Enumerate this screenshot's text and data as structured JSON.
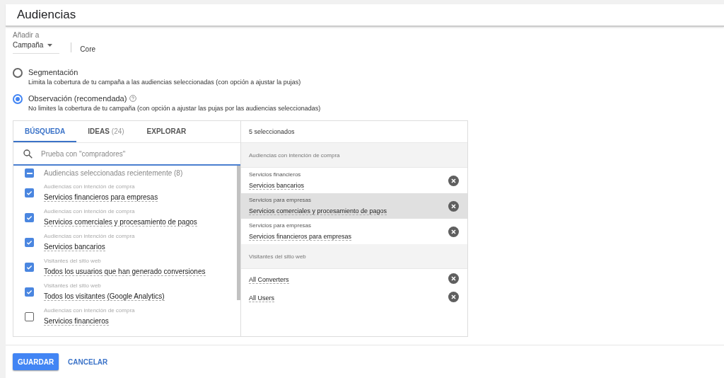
{
  "title": "Audiencias",
  "add_to": {
    "label": "Añadir a",
    "value": "Campaña",
    "campaign": "Core"
  },
  "options": [
    {
      "label": "Segmentación",
      "description": "Limita la cobertura de tu campaña a las audiencias seleccionadas (con opción a ajustar la pujas)",
      "selected": false,
      "help": false
    },
    {
      "label": "Observación (recomendada)",
      "description": "No limites la cobertura de tu campaña (con opción a ajustar las pujas por las audiencias seleccionadas)",
      "selected": true,
      "help": true
    }
  ],
  "tabs": [
    {
      "label": "BÚSQUEDA",
      "selected": true
    },
    {
      "label": "IDEAS",
      "count": "(24)",
      "selected": false
    },
    {
      "label": "EXPLORAR",
      "selected": false
    }
  ],
  "search": {
    "placeholder": "Prueba con \"compradores\""
  },
  "group_header": {
    "label": "Audiencias seleccionadas recientemente (8)",
    "indeterminate": true
  },
  "audiences": [
    {
      "category": "Audiencias con intención de compra",
      "name": "Servicios financieros para empresas",
      "checked": true
    },
    {
      "category": "Audiencias con intención de compra",
      "name": "Servicios comerciales y procesamiento de pagos",
      "checked": true
    },
    {
      "category": "Audiencias con intención de compra",
      "name": "Servicios bancarios",
      "checked": true
    },
    {
      "category": "Visitantes del sitio web",
      "name": "Todos los usuarios que han generado conversiones",
      "checked": true
    },
    {
      "category": "Visitantes del sitio web",
      "name": "Todos los visitantes (Google Analytics)",
      "checked": true
    },
    {
      "category": "Audiencias con intención de compra",
      "name": "Servicios financieros",
      "checked": false
    }
  ],
  "selected_panel": {
    "count_label": "5 seleccionados",
    "groups": [
      {
        "title": "Audiencias con intención de compra",
        "items": [
          {
            "parent": "Servicios financieros",
            "name": "Servicios bancarios",
            "highlighted": false
          },
          {
            "parent": "Servicios para empresas",
            "name": "Servicios comerciales y procesamiento de pagos",
            "highlighted": true
          },
          {
            "parent": "Servicios para empresas",
            "name": "Servicios financieros para empresas",
            "highlighted": false
          }
        ]
      },
      {
        "title": "Visitantes del sitio web",
        "items": [
          {
            "name": "All Converters",
            "highlighted": false
          },
          {
            "name": "All Users",
            "highlighted": false
          }
        ]
      }
    ]
  },
  "buttons": [
    {
      "label": "GUARDAR",
      "kind": "primary"
    },
    {
      "label": "CANCELAR",
      "kind": "text"
    }
  ]
}
